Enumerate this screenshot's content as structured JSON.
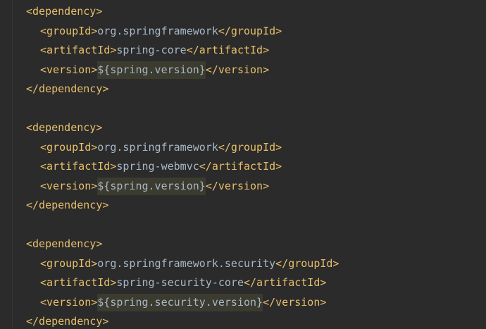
{
  "blocks": [
    {
      "open": "<dependency>",
      "group_open": "<groupId>",
      "group_value": "org.springframework",
      "group_close": "</groupId>",
      "artifact_open": "<artifactId>",
      "artifact_value": "spring-core",
      "artifact_close": "</artifactId>",
      "version_open": "<version>",
      "version_value": "${spring.version}",
      "version_close": "</version>",
      "close": "</dependency>"
    },
    {
      "open": "<dependency>",
      "group_open": "<groupId>",
      "group_value": "org.springframework",
      "group_close": "</groupId>",
      "artifact_open": "<artifactId>",
      "artifact_value": "spring-webmvc",
      "artifact_close": "</artifactId>",
      "version_open": "<version>",
      "version_value": "${spring.version}",
      "version_close": "</version>",
      "close": "</dependency>"
    },
    {
      "open": "<dependency>",
      "group_open": "<groupId>",
      "group_value": "org.springframework.security",
      "group_close": "</groupId>",
      "artifact_open": "<artifactId>",
      "artifact_value": "spring-security-core",
      "artifact_close": "</artifactId>",
      "version_open": "<version>",
      "version_value": "${spring.security.version}",
      "version_close": "</version>",
      "close": "</dependency>"
    }
  ],
  "colors": {
    "background": "#2b2b2b",
    "tag": "#e8bf6a",
    "text": "#a9b7c6",
    "highlight": "#3b3b2f"
  }
}
